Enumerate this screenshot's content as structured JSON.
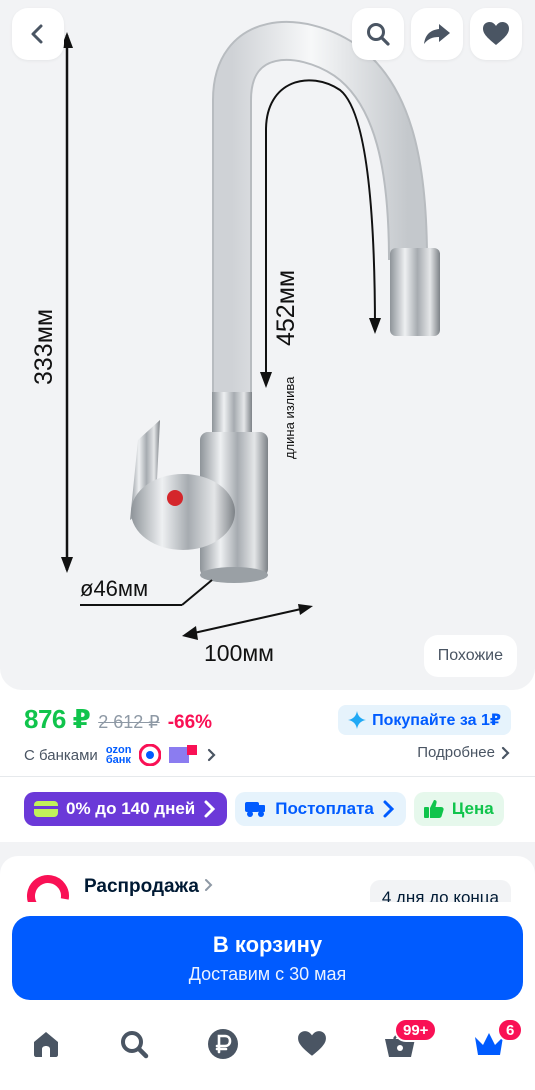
{
  "gallery": {
    "dimensions": {
      "height": "333мм",
      "spout": "452мм",
      "spout_caption": "длина излива",
      "diameter": "ø46мм",
      "width": "100мм"
    },
    "similar_label": "Похожие"
  },
  "pricing": {
    "price": "876 ₽",
    "old_price": "2 612 ₽",
    "discount": "-66%",
    "promo_label": "Покупайте за 1₽",
    "banks_label": "С банками",
    "ozon_bank_line1": "ozon",
    "ozon_bank_line2": "банк",
    "more_label": "Подробнее"
  },
  "chips": [
    {
      "label": "0% до 140 дней"
    },
    {
      "label": "Постоплата"
    },
    {
      "label": "Цена"
    }
  ],
  "sale": {
    "title": "Распродажа",
    "badge": "4 дня до конца"
  },
  "cart_button": {
    "title": "В корзину",
    "subtitle": "Доставим с 30 мая"
  },
  "tabbar": {
    "cart_badge": "99+",
    "profile_badge": "6"
  },
  "colors": {
    "accent": "#005bff",
    "price_green": "#10c44c",
    "discount_red": "#f91155",
    "installment_purple": "#6b39d8"
  }
}
